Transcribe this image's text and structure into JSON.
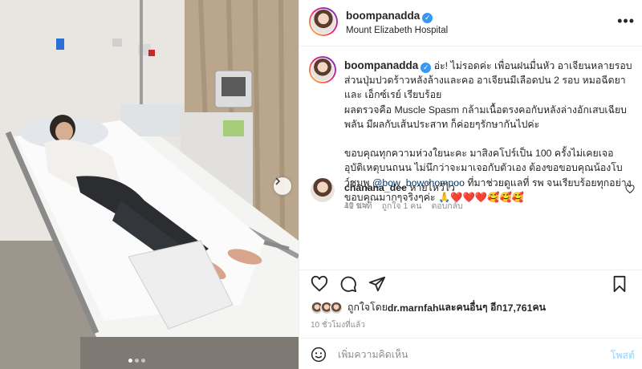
{
  "post": {
    "username": "boompanadda",
    "location": "Mount Elizabeth Hospital",
    "verified_icon": "verified-badge-icon",
    "more_icon": "more-options-icon"
  },
  "caption": {
    "username": "boompanadda",
    "lines": [
      "อ่ะ! ไม่รอดค่ะ เพื่อนฝนมื่นหัว อาเจียนหลายรอบ",
      "ส่วนปุ่มปวดร้าวหลังล้างและคอ อาเจียนมีเลือดปน 2 รอบ หมอฉีดยา",
      "และ เอ็กซ์เรย์ เรียบร้อย",
      "ผลตรวจคือ Muscle Spasm กล้ามเนื้อตรงคอกับหลังล่างอักเสบเฉียบ",
      "พลัน มีผลกับเส้นประสาท ก็ค่อยๆรักษากันไปค่ะ",
      "",
      "ขอบคุณทุกความห่วงใยนะคะ มาสิงคโปร์เป็น 100 ครั้งไม่เคยเจอ",
      "อุบัติเหตุบนถนน ไม่นึกว่าจะมาเจอกับตัวเอง ต้องขอขอบคุณน้องโบ",
      "ว์ชมพู"
    ],
    "mention": "@bow_bowchompoo",
    "after_mention": " ที่มาช่วยดูแลที่ รพ จนเรียบร้อยทุกอย่าง",
    "last_line": "ขอบคุณมากๆจริงๆค่ะ 🙏❤️❤️❤️🥰🥰🥰",
    "time": "10 ชม."
  },
  "comment": {
    "username": "chanana_dee",
    "text": "หายไหว้ไว",
    "time": "41 นาที",
    "likes": "ถูกใจ 1 คน",
    "reply": "ตอบกลับ"
  },
  "likes": {
    "prefix": "ถูกใจโดย ",
    "user": "dr.marnfah",
    "mid": " และคนอื่นๆ อีก ",
    "count": "17,761",
    "suffix": " คน"
  },
  "post_time": "10 ชั่วโมงที่แล้ว",
  "add_comment": {
    "placeholder": "เพิ่มความคิดเห็น",
    "post_label": "โพสต์"
  },
  "colors": {
    "link": "#00376b",
    "verified": "#3897f0",
    "muted": "#8e8e8e",
    "post_disabled": "#b2dffc"
  }
}
